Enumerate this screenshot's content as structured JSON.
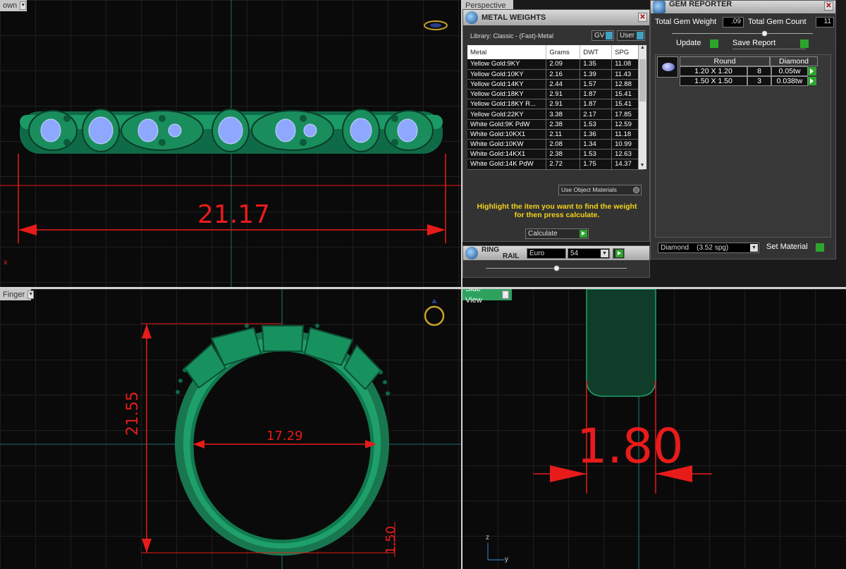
{
  "viewports": {
    "top_left": {
      "tab": "own",
      "dim_width": "21.17"
    },
    "bottom_left": {
      "tab": "Finger",
      "dim_height": "21.55",
      "dim_inner": "17.29",
      "dim_shank": "1.50"
    },
    "bottom_right": {
      "tab": "Side View",
      "dim_thickness": "1.80",
      "axis_z": "z",
      "axis_y": "y"
    },
    "top_right": {
      "tab": "Perspective"
    },
    "axis_x": "x"
  },
  "metal_weights": {
    "title": "METAL WEIGHTS",
    "library_label": "Library: Classic - (Fast)-Metal",
    "gv_label": "GV",
    "user_label": "User",
    "columns": [
      "Metal",
      "Grams",
      "DWT",
      "SPG"
    ],
    "rows": [
      [
        "Yellow Gold:9KY",
        "2.09",
        "1.35",
        "11.08"
      ],
      [
        "Yellow Gold:10KY",
        "2.16",
        "1.39",
        "11.43"
      ],
      [
        "Yellow Gold:14KY",
        "2.44",
        "1.57",
        "12.88"
      ],
      [
        "Yellow Gold:18KY",
        "2.91",
        "1.87",
        "15.41"
      ],
      [
        "Yellow Gold:18KY R...",
        "2.91",
        "1.87",
        "15.41"
      ],
      [
        "Yellow Gold:22KY",
        "3.38",
        "2.17",
        "17.85"
      ],
      [
        "White Gold:9K PdW",
        "2.38",
        "1.53",
        "12.59"
      ],
      [
        "White Gold:10KX1",
        "2.11",
        "1.36",
        "11.18"
      ],
      [
        "White Gold:10KW",
        "2.08",
        "1.34",
        "10.99"
      ],
      [
        "White Gold:14KX1",
        "2.38",
        "1.53",
        "12.63"
      ],
      [
        "White Gold:14K PdW",
        "2.72",
        "1.75",
        "14.37"
      ]
    ],
    "use_object_materials": "Use Object Materials",
    "hint": "Highlight the item you want to find the weight for then press calculate.",
    "calculate_label": "Calculate"
  },
  "ring_rail": {
    "title_line1": "RING",
    "title_line2": "RAIL",
    "standard": "Euro",
    "size": "54"
  },
  "gem_reporter": {
    "title": "GEM REPORTER",
    "total_weight_label": "Total Gem Weight",
    "total_weight_value": ".09",
    "total_count_label": "Total Gem Count",
    "total_count_value": "11",
    "update_label": "Update",
    "save_report_label": "Save Report",
    "header_shape": "Round",
    "header_material": "Diamond",
    "gems": [
      {
        "size": "1.20 X 1.20",
        "count": "8",
        "weight": "0.05tw"
      },
      {
        "size": "1.50 X 1.50",
        "count": "3",
        "weight": "0.038tw"
      }
    ],
    "material_select": "Diamond    (3.52 spg)",
    "set_material_label": "Set Material"
  },
  "colors": {
    "metal": "#1d9a6a",
    "dimension": "#e81b1b",
    "gem": "#8fa8ff",
    "accent_hint": "#f2d21b"
  }
}
